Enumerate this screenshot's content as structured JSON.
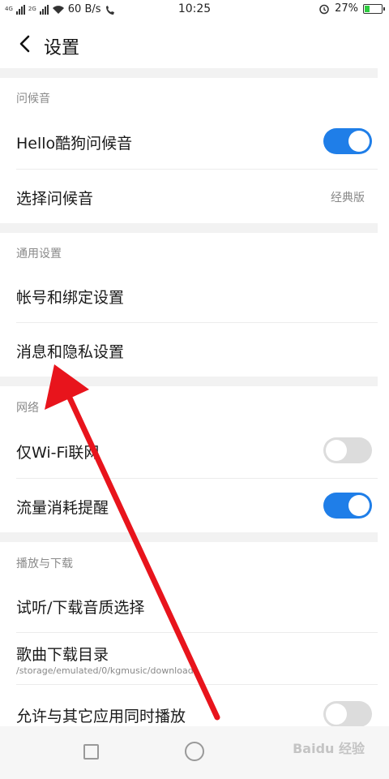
{
  "status_bar": {
    "net1": "4G",
    "net2": "2G",
    "speed": "60 B/s",
    "hd": "HD",
    "time": "10:25",
    "battery": "27%",
    "battery_level": 0.27
  },
  "header": {
    "title": "设置"
  },
  "sections": {
    "greeting": {
      "label": "问候音",
      "hello_label": "Hello酷狗问候音",
      "hello_on": true,
      "choose_label": "选择问候音",
      "choose_value": "经典版"
    },
    "general": {
      "label": "通用设置",
      "account_label": "帐号和绑定设置",
      "privacy_label": "消息和隐私设置"
    },
    "network": {
      "label": "网络",
      "wifi_label": "仅Wi-Fi联网",
      "wifi_on": false,
      "data_label": "流量消耗提醒",
      "data_on": true
    },
    "playback": {
      "label": "播放与下载",
      "quality_label": "试听/下载音质选择",
      "dir_label": "歌曲下载目录",
      "dir_path": "/storage/emulated/0/kgmusic/download",
      "mix_label": "允许与其它应用同时播放",
      "mix_on": false
    }
  },
  "watermark": "Baidu 经验",
  "colors": {
    "toggle_on": "#1f7ee8",
    "toggle_off": "#dcdcdc",
    "arrow": "#e8141c"
  }
}
